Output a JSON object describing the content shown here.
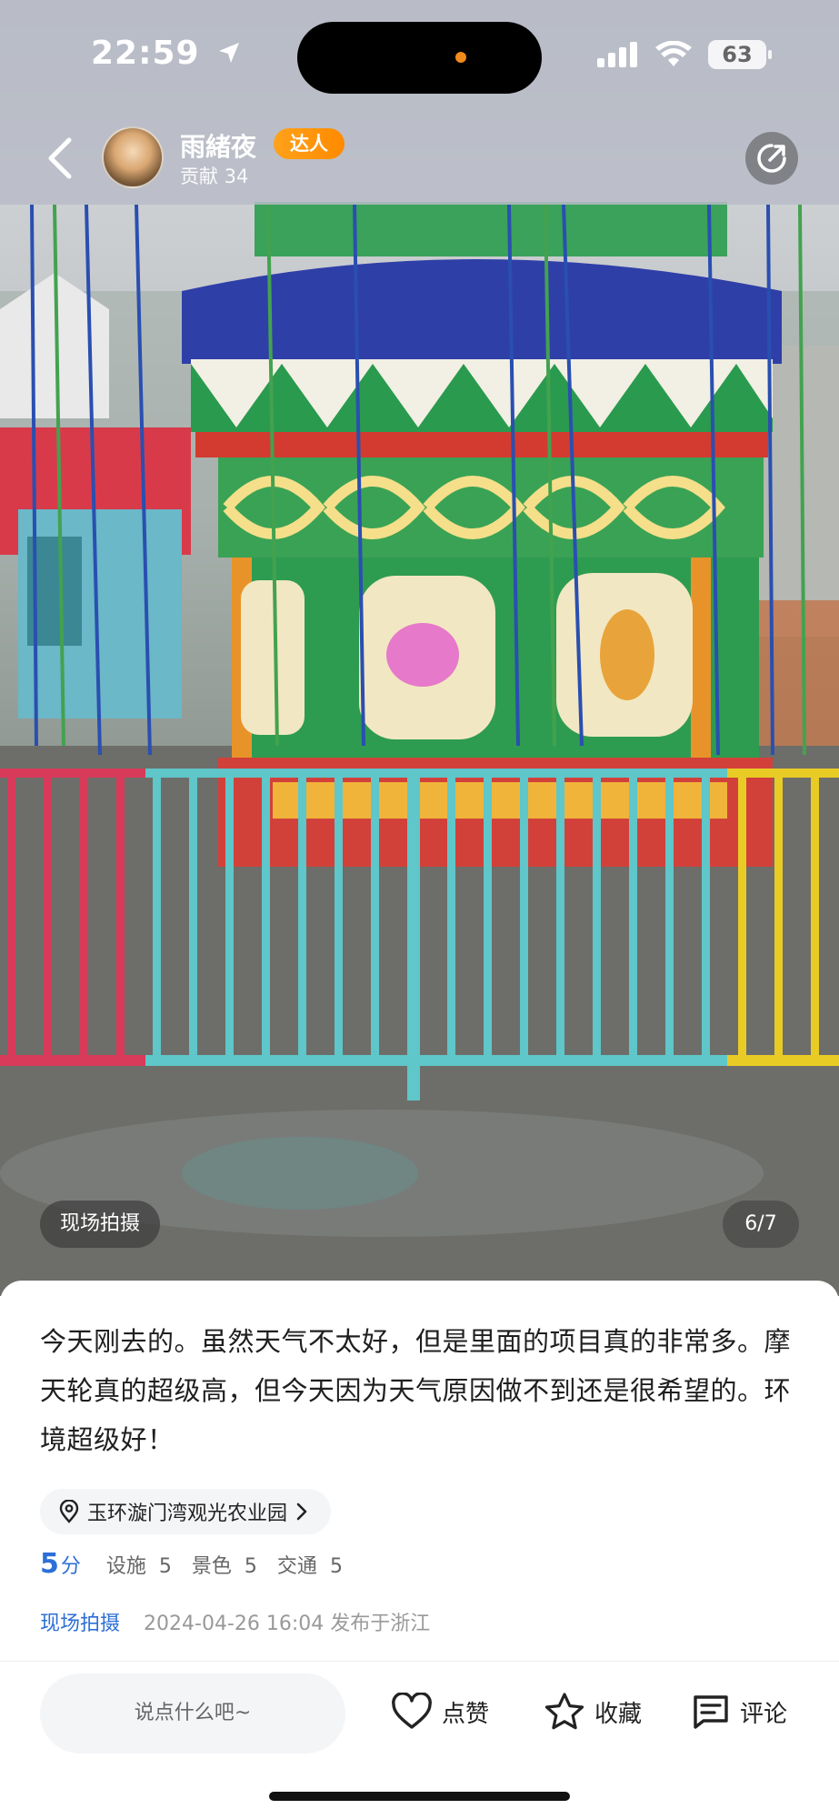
{
  "status_bar": {
    "time": "22:59",
    "battery": "63"
  },
  "header": {
    "user_name": "雨緒夜",
    "badge": "达人",
    "contribution": "贡献 34"
  },
  "photo": {
    "tag": "现场拍摄",
    "counter": "6/7"
  },
  "post": {
    "text": "今天刚去的。虽然天气不太好，但是里面的项目真的非常多。摩天轮真的超级高，但今天因为天气原因做不到还是很希望的。环境超级好！",
    "location": "玉环漩门湾观光农业园",
    "rating": {
      "score": "5",
      "unit": "分",
      "sub": [
        {
          "label": "设施",
          "value": "5"
        },
        {
          "label": "景色",
          "value": "5"
        },
        {
          "label": "交通",
          "value": "5"
        }
      ]
    },
    "meta_tag": "现场拍摄",
    "meta_info": "2024-04-26 16:04 发布于浙江"
  },
  "bottom_bar": {
    "comment_placeholder": "说点什么吧~",
    "like_label": "点赞",
    "favorite_label": "收藏",
    "comment_label": "评论"
  },
  "colors": {
    "accent_blue": "#2d6fd6",
    "badge_orange": "#ff9a0d"
  },
  "icons": [
    "location-arrow-icon",
    "signal-icon",
    "wifi-icon",
    "battery-icon",
    "back-chevron-icon",
    "share-icon",
    "location-pin-icon",
    "chevron-right-icon",
    "heart-icon",
    "star-icon",
    "comment-icon"
  ]
}
